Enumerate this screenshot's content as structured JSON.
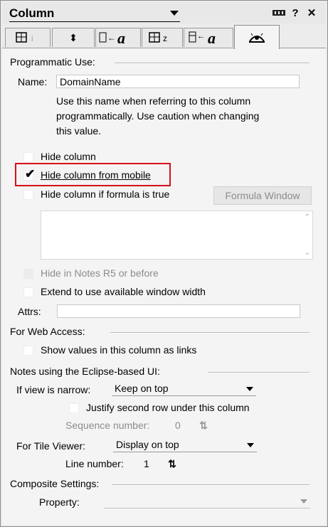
{
  "window": {
    "title": "Column"
  },
  "tabs": [
    "tab-basics",
    "tab-sorting",
    "tab-font",
    "tab-numbers",
    "tab-title-styles",
    "tab-advanced"
  ],
  "programmatic": {
    "section_title": "Programmatic Use:",
    "name_label": "Name:",
    "name_value": "DomainName",
    "help_line1": "Use this name when referring to this column",
    "help_line2": "programmatically.  Use caution when changing",
    "help_line3": "this value."
  },
  "options": {
    "hide_column": "Hide column",
    "hide_from_mobile": "Hide column from mobile",
    "hide_if_formula": "Hide column if formula is true",
    "formula_button": "Formula Window",
    "hide_in_notes_r5": "Hide in Notes R5 or before",
    "extend_width": "Extend to use available window width",
    "attrs_label": "Attrs:",
    "attrs_value": ""
  },
  "web": {
    "section_title": "For Web Access:",
    "show_links": "Show values in this column as links"
  },
  "eclipse": {
    "section_title": "Notes using the  Eclipse-based UI:",
    "narrow_label": "If view is narrow:",
    "narrow_value": "Keep on top",
    "justify_label": "Justify second row under this column",
    "sequence_label": "Sequence number:",
    "sequence_value": "0",
    "tile_label": "For Tile Viewer:",
    "tile_value": "Display on top",
    "line_label": "Line number:",
    "line_value": "1"
  },
  "composite": {
    "section_title": "Composite Settings:",
    "property_label": "Property:",
    "property_value": ""
  },
  "state": {
    "hide_column_checked": false,
    "hide_from_mobile_checked": true,
    "hide_if_formula_checked": false,
    "hide_in_notes_r5_checked": false,
    "extend_width_checked": false,
    "show_links_checked": false,
    "justify_checked": false
  },
  "colors": {
    "highlight_box": "#d8101a",
    "panel_bg": "#f4f4f4",
    "disabled_text": "#8c8c8c"
  }
}
